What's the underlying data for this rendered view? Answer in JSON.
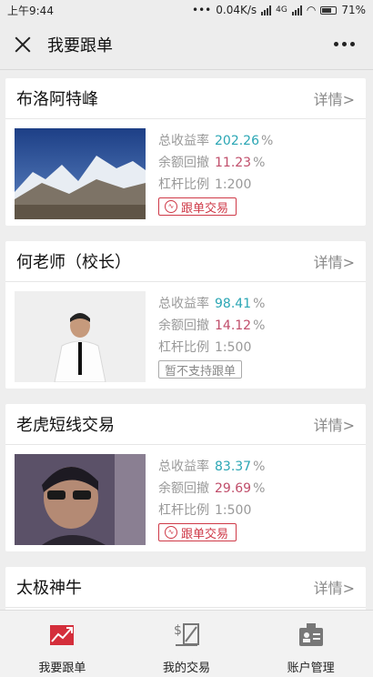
{
  "status": {
    "time": "上午9:44",
    "right_text": "0.04K/s",
    "net": "4G",
    "battery": "71%"
  },
  "header": {
    "title": "我要跟单"
  },
  "detail_label": "详情>",
  "stat_labels": {
    "return": "总收益率",
    "drawdown": "余额回撤",
    "leverage": "杠杆比例",
    "pct": "%"
  },
  "traders": [
    {
      "name": "布洛阿特峰",
      "return": "202.26",
      "drawdown": "11.23",
      "leverage": "1:200",
      "button": "跟单交易",
      "button_enabled": true,
      "image": "mountain"
    },
    {
      "name": "何老师（校长）",
      "return": "98.41",
      "drawdown": "14.12",
      "leverage": "1:500",
      "button": "暂不支持跟单",
      "button_enabled": false,
      "image": "man-suit"
    },
    {
      "name": "老虎短线交易",
      "return": "83.37",
      "drawdown": "29.69",
      "leverage": "1:500",
      "button": "跟单交易",
      "button_enabled": true,
      "image": "man-selfie"
    },
    {
      "name": "太极神牛"
    }
  ],
  "tabs": [
    {
      "label": "我要跟单",
      "icon": "chart-trend-icon",
      "active": true
    },
    {
      "label": "我的交易",
      "icon": "dollar-chart-icon",
      "active": false
    },
    {
      "label": "账户管理",
      "icon": "id-card-icon",
      "active": false
    }
  ],
  "colors": {
    "return": "#2aa6b4",
    "drawdown": "#c04d6a",
    "accent": "#cf3a48"
  }
}
